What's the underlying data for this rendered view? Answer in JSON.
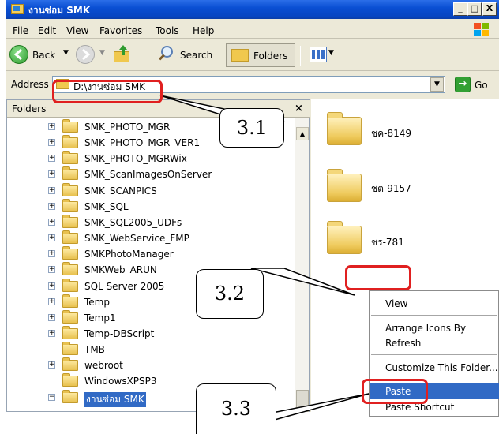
{
  "window": {
    "title": "งานซ่อม SMK",
    "buttons": {
      "minimize": "_",
      "maximize": "□",
      "close": "X"
    }
  },
  "menu": [
    "File",
    "Edit",
    "View",
    "Favorites",
    "Tools",
    "Help"
  ],
  "toolbar": {
    "back": "Back",
    "search": "Search",
    "folders": "Folders"
  },
  "address": {
    "label": "Address",
    "value": "D:\\งานซ่อม SMK",
    "go": "Go"
  },
  "folders_pane": {
    "title": "Folders",
    "close": "×",
    "tree": [
      {
        "label": "SMK_PHOTO_MGR",
        "expander": "+"
      },
      {
        "label": "SMK_PHOTO_MGR_VER1",
        "expander": "+"
      },
      {
        "label": "SMK_PHOTO_MGRWix",
        "expander": "+"
      },
      {
        "label": "SMK_ScanImagesOnServer",
        "expander": "+"
      },
      {
        "label": "SMK_SCANPICS",
        "expander": "+"
      },
      {
        "label": "SMK_SQL",
        "expander": "+"
      },
      {
        "label": "SMK_SQL2005_UDFs",
        "expander": "+"
      },
      {
        "label": "SMK_WebService_FMP",
        "expander": "+"
      },
      {
        "label": "SMKPhotoManager",
        "expander": "+"
      },
      {
        "label": "SMKWeb_ARUN",
        "expander": "+"
      },
      {
        "label": "SQL Server 2005",
        "expander": "+"
      },
      {
        "label": "Temp",
        "expander": "+"
      },
      {
        "label": "Temp1",
        "expander": "+"
      },
      {
        "label": "Temp-DBScript",
        "expander": "+"
      },
      {
        "label": "TMB",
        "expander": ""
      },
      {
        "label": "webroot",
        "expander": "+"
      },
      {
        "label": "WindowsXPSP3",
        "expander": ""
      },
      {
        "label": "งานซ่อม SMK",
        "expander": "−",
        "selected": true
      }
    ]
  },
  "content": {
    "folders": [
      "ชค-8149",
      "ชต-9157",
      "ชร-781"
    ]
  },
  "context_menu": {
    "items": [
      "View",
      "Arrange Icons By",
      "Refresh",
      "Customize This Folder...",
      "Paste",
      "Paste Shortcut"
    ],
    "highlighted": "Paste"
  },
  "annotations": {
    "callouts": [
      "3.1",
      "3.2",
      "3.3"
    ]
  },
  "colors": {
    "titlebar": "#0a4fd3",
    "highlight": "#316ac5",
    "annotation_red": "#e02020",
    "chrome": "#ece9d8"
  }
}
